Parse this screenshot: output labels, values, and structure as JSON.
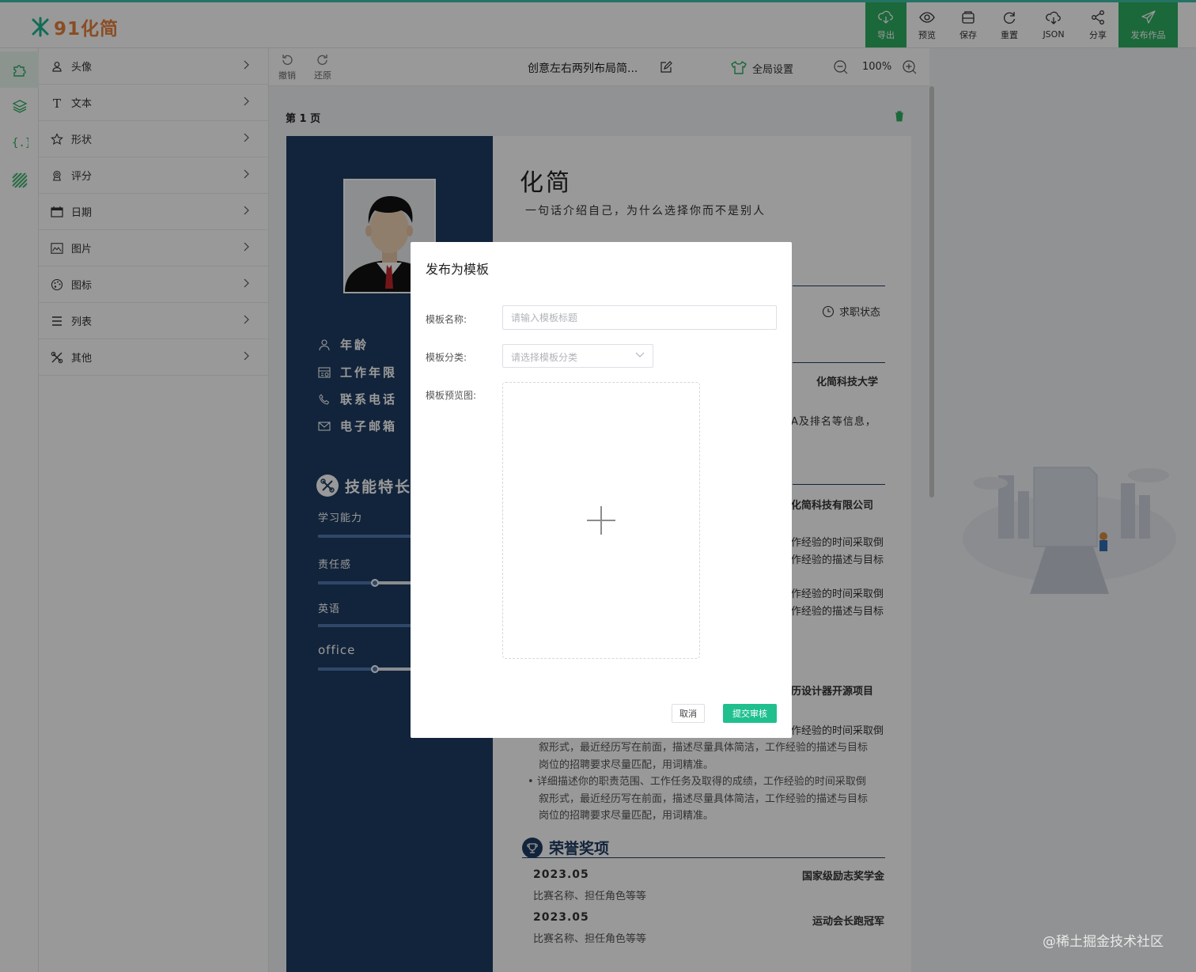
{
  "app": {
    "logo_text": "91化简",
    "accent_color": "#2ead61",
    "logo_color": "#e6813c"
  },
  "toolbar": {
    "export": "导出",
    "preview": "预览",
    "save": "保存",
    "reset": "重置",
    "json": "JSON",
    "share": "分享",
    "publish": "发布作品"
  },
  "rail": {
    "items": [
      {
        "icon": "puzzle-icon"
      },
      {
        "icon": "layers-icon"
      },
      {
        "icon": "code-braces-icon"
      },
      {
        "icon": "stripes-icon"
      }
    ]
  },
  "menu": {
    "items": [
      {
        "label": "头像",
        "icon": "user-icon"
      },
      {
        "label": "文本",
        "icon": "text-icon"
      },
      {
        "label": "形状",
        "icon": "star-icon"
      },
      {
        "label": "评分",
        "icon": "award-icon"
      },
      {
        "label": "日期",
        "icon": "calendar-icon"
      },
      {
        "label": "图片",
        "icon": "image-icon"
      },
      {
        "label": "图标",
        "icon": "palette-icon"
      },
      {
        "label": "列表",
        "icon": "list-icon"
      },
      {
        "label": "其他",
        "icon": "tools-icon"
      }
    ]
  },
  "subbar": {
    "undo": "撤销",
    "redo": "还原",
    "doc_title": "创意左右两列布局简...",
    "global_settings": "全局设置",
    "zoom": "100%"
  },
  "canvas": {
    "page_label": "第 1 页"
  },
  "resume": {
    "name": "化简",
    "tagline": "一句话介绍自己，为什么选择你而不是别人",
    "job_status": "求职状态",
    "left_info": [
      "年龄",
      "工作年限",
      "联系电话",
      "电子邮箱"
    ],
    "skills_title": "技能特长",
    "skills": [
      {
        "name": "学习能力",
        "level": 1.0
      },
      {
        "name": "责任感",
        "level": 0.36
      },
      {
        "name": "英语",
        "level": 1.0
      },
      {
        "name": "office",
        "level": 0.36
      }
    ],
    "university": "化简科技大学",
    "university_desc": "A及排名等信息，",
    "company": "化简科技有限公司",
    "work_line_a": "作经验的时间采取倒",
    "work_line_b": "作经验的描述与目标",
    "project": "历设计器开源项目",
    "bullet_1a": "详细描述你的职责范围、工作任务及取得的成绩，工作经验的时间采取倒",
    "bullet_1b": "叙形式，最近经历写在前面，描述尽量具体简洁，工作经验的描述与目标",
    "bullet_1c": "岗位的招聘要求尽量匹配，用词精准。",
    "honors_title": "荣誉奖项",
    "honors": [
      {
        "date": "2023.05",
        "title": "国家级励志奖学金",
        "desc": "比赛名称、担任角色等等"
      },
      {
        "date": "2023.05",
        "title": "运动会长跑冠军",
        "desc": "比赛名称、担任角色等等"
      }
    ]
  },
  "modal": {
    "title": "发布为模板",
    "name_label": "模板名称:",
    "name_placeholder": "请输入模板标题",
    "name_value": "",
    "category_label": "模板分类:",
    "category_placeholder": "请选择模板分类",
    "preview_label": "模板预览图:",
    "cancel": "取消",
    "submit": "提交审核",
    "submit_color": "#1fc08e"
  },
  "watermark": "@稀土掘金技术社区"
}
